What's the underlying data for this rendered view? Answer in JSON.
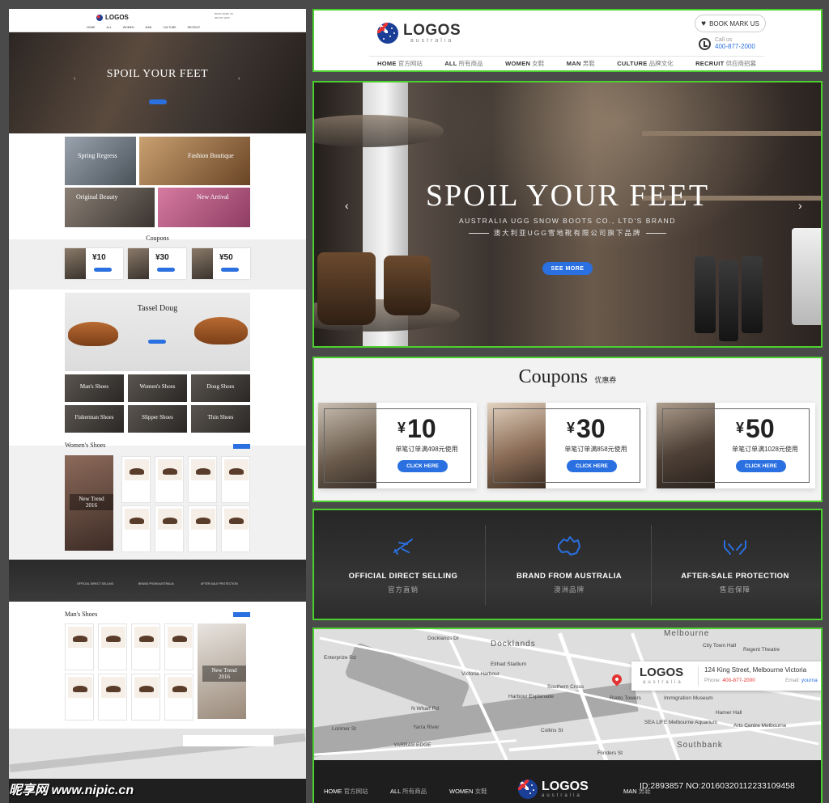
{
  "brand": {
    "logo": "LOGOS",
    "logo_sub": "australia",
    "bookmark": "BOOK MARK US",
    "call_label": "Call us",
    "phone": "400-877-2000"
  },
  "nav": [
    {
      "en": "HOME",
      "cn": "官方网站"
    },
    {
      "en": "ALL",
      "cn": "所有商品"
    },
    {
      "en": "WOMEN",
      "cn": "女鞋"
    },
    {
      "en": "MAN",
      "cn": "男鞋"
    },
    {
      "en": "CULTURE",
      "cn": "品牌文化"
    },
    {
      "en": "RECRUIT",
      "cn": "供应商招募"
    }
  ],
  "hero": {
    "title": "SPOIL YOUR FEET",
    "subtitle_en": "AUSTRALIA UGG SNOW BOOTS CO., LTD'S BRAND",
    "subtitle_cn": "澳大利亚UGG雪地靴有限公司旗下品牌",
    "button": "SEE MORE",
    "prev": "‹",
    "next": "›"
  },
  "coupons": {
    "title_en": "Coupons",
    "title_cn": "优惠券",
    "currency": "¥",
    "items": [
      {
        "value": "10",
        "condition": "单笔订单满498元使用",
        "button": "CLICK HERE"
      },
      {
        "value": "30",
        "condition": "单笔订单满858元使用",
        "button": "CLICK HERE"
      },
      {
        "value": "50",
        "condition": "单笔订单满1028元使用",
        "button": "CLICK HERE"
      }
    ]
  },
  "features": [
    {
      "icon": "airplane-icon",
      "en": "OFFICIAL DIRECT SELLING",
      "cn": "官方直销"
    },
    {
      "icon": "australia-map-icon",
      "en": "BRAND FROM AUSTRALIA",
      "cn": "澳洲品牌"
    },
    {
      "icon": "hands-protect-icon",
      "en": "AFTER-SALE PROTECTION",
      "cn": "售后保障"
    }
  ],
  "map": {
    "labels": [
      "Melbourne",
      "City Town Hall",
      "Regent Theatre",
      "Docklands",
      "Etihad Stadium",
      "Enterprize Rd",
      "Victoria Harbour",
      "Southern Cross",
      "Rialto Towers",
      "Immigration Museum",
      "SEA LIFE Melbourne Aquarium",
      "Arts Centre Melbourne",
      "Hamer Hall",
      "Southbank",
      "N Wharf Rd",
      "Yarra River",
      "Lorimer St",
      "YARRAS EDGE",
      "Collins St",
      "Docklands Dr",
      "Harbour Esplanade",
      "Flinders St"
    ],
    "card_address": "124 King Street, Melbourne Victoria",
    "card_phone_label": "Phone:",
    "card_phone": "400-877-2000",
    "card_email_label": "Email:",
    "card_email": "yourna"
  },
  "footer_nav": [
    {
      "en": "HOME",
      "cn": "官方网站"
    },
    {
      "en": "ALL",
      "cn": "所有商品"
    },
    {
      "en": "WOMEN",
      "cn": "女鞋"
    },
    {
      "en": "MAN",
      "cn": "男鞋"
    }
  ],
  "thumb": {
    "hero_title": "SPOIL YOUR FEET",
    "cats": [
      "Spring Regress",
      "Fashion Boutique",
      "Original Beauty",
      "New Arrival"
    ],
    "coupons_title": "Coupons",
    "coupon_values": [
      "¥10",
      "¥30",
      "¥50"
    ],
    "tassel": "Tassel Doug",
    "grid": [
      "Man's Shoes",
      "Women's Shoes",
      "Doug Shoes",
      "Fisherman Shoes",
      "Slipper Shoes",
      "Thin Shoes"
    ],
    "women_title": "Women's Shoes",
    "man_title": "Man's Shoes",
    "new_trend": "New Trend 2016"
  },
  "watermark_left": "昵享网 www.nipic.cn",
  "watermark_right": "ID:2893857 NO:20160320112233109458"
}
